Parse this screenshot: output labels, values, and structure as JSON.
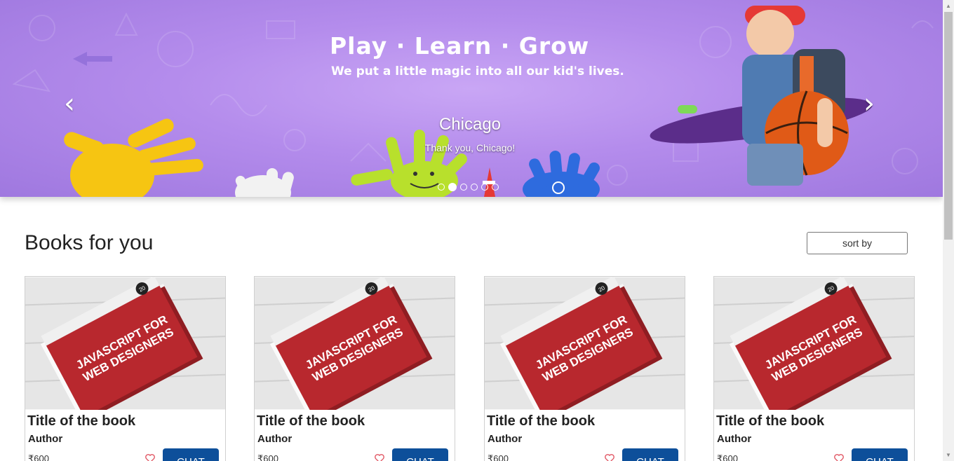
{
  "carousel": {
    "headline": "Play · Learn · Grow",
    "subline": "We put a little magic into all our kid's lives.",
    "caption_title": "Chicago",
    "caption_text": "Thank you, Chicago!",
    "prev_icon": "‹",
    "next_icon": "›",
    "slide_count": 6,
    "active_slide": 2,
    "background_color": "#b48cec"
  },
  "section": {
    "title": "Books for you",
    "sort_label": "sort by"
  },
  "books": [
    {
      "title": "Title of the book",
      "author": "Author",
      "price": "₹600",
      "chat_label": "CHAT",
      "cover_text": [
        "JAVASCRIPT FOR",
        "WEB DESIGNERS"
      ],
      "cover_number": "20"
    },
    {
      "title": "Title of the book",
      "author": "Author",
      "price": "₹600",
      "chat_label": "CHAT",
      "cover_text": [
        "JAVASCRIPT FOR",
        "WEB DESIGNERS"
      ],
      "cover_number": "20"
    },
    {
      "title": "Title of the book",
      "author": "Author",
      "price": "₹600",
      "chat_label": "CHAT",
      "cover_text": [
        "JAVASCRIPT FOR",
        "WEB DESIGNERS"
      ],
      "cover_number": "20"
    },
    {
      "title": "Title of the book",
      "author": "Author",
      "price": "₹600",
      "chat_label": "CHAT",
      "cover_text": [
        "JAVASCRIPT FOR",
        "WEB DESIGNERS"
      ],
      "cover_number": "20"
    }
  ],
  "colors": {
    "chat_button": "#0d4f9a",
    "heart": "#e05260",
    "book_cover": "#b8282e"
  }
}
